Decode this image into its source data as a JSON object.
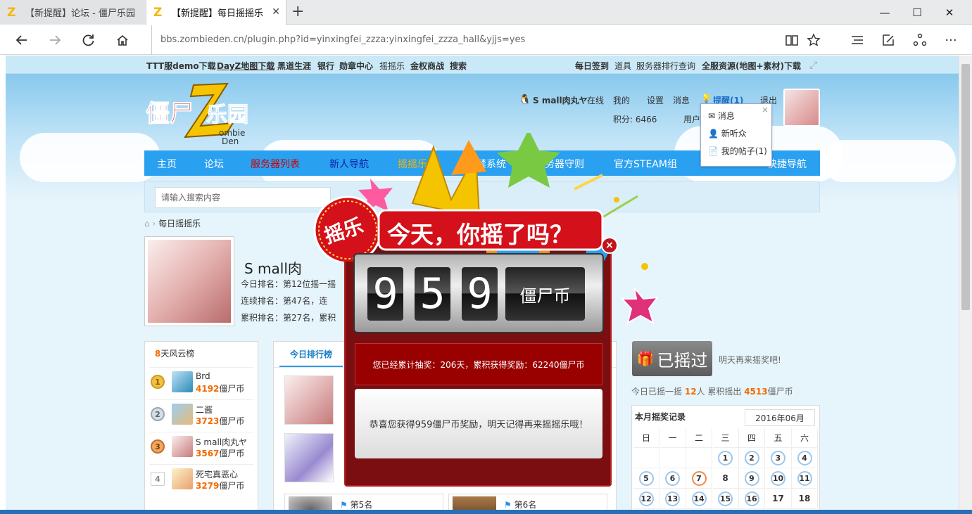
{
  "browser": {
    "tabs": [
      {
        "title": "【新提醒】论坛 - 僵尸乐园"
      },
      {
        "title": "【新提醒】每日摇摇乐"
      }
    ],
    "url": "bbs.zombieden.cn/plugin.php?id=yinxingfei_zzza:yinxingfei_zzza_hall&yjjs=yes",
    "window_controls": {
      "minimize": "—",
      "maximize": "☐",
      "close": "✕"
    }
  },
  "toplinks": {
    "left": [
      {
        "label": "TTT服demo下载",
        "color": "#0b4ab7"
      },
      {
        "label": "DayZ地图下载",
        "color": "#f5a100"
      },
      {
        "label": "黑道生涯",
        "color": "#d40000"
      },
      {
        "label": "银行",
        "color": "#0b4ab7"
      },
      {
        "label": "勋章中心",
        "color": "#0b4ab7"
      },
      {
        "label": "摇摇乐",
        "color": "#555555"
      },
      {
        "label": "金权商战",
        "color": "#1b7f1b"
      },
      {
        "label": "搜索",
        "color": "#333333"
      }
    ],
    "right": [
      {
        "label": "每日签到",
        "color": "#d40000"
      },
      {
        "label": "道具",
        "color": "#333333"
      },
      {
        "label": "服务器排行查询",
        "color": "#333333"
      },
      {
        "label": "全服资源(地图+素材)下载",
        "color": "#7b0fa8"
      }
    ]
  },
  "userbar": {
    "username": "S mall肉丸ヤ",
    "online": "在线",
    "mine": "我的",
    "settings": "设置",
    "messages": "消息",
    "reminder": "提醒(1)",
    "logout": "退出",
    "points": "积分: 6466",
    "user_group": "用户"
  },
  "notice_dropdown": {
    "items": [
      "消息",
      "新听众",
      "我的帖子(1)"
    ]
  },
  "mainnav": [
    {
      "label": "主页",
      "color": "#ffffff"
    },
    {
      "label": "论坛",
      "color": "#ffffff"
    },
    {
      "label": "服务器列表",
      "color": "#d00000"
    },
    {
      "label": "新人导航",
      "color": "#0a1fa8"
    },
    {
      "label": "摇摇乐",
      "color": "#f5b700"
    },
    {
      "label": "封禁系统",
      "color": "#ffffff"
    },
    {
      "label": "服务器守则",
      "color": "#ffffff"
    },
    {
      "label": "官方STEAM组",
      "color": "#ffffff"
    },
    {
      "label": "快捷导航",
      "color": "#ffffff"
    }
  ],
  "search": {
    "placeholder": "请输入搜索内容"
  },
  "breadcrumb": {
    "current": "每日摇摇乐"
  },
  "profile": {
    "name": "S mall肉",
    "today_rank": "今日排名：第12位摇一摇",
    "streak_rank": "连续排名：第47名，连",
    "total_rank": "累积排名：第27名，累积"
  },
  "left_board": {
    "title": "8天风云榜",
    "title_number": "8",
    "unit": "僵尸币",
    "rows": [
      {
        "rank": "1",
        "name": "Brd",
        "coins": "4192"
      },
      {
        "rank": "2",
        "name": "二酱",
        "coins": "3723"
      },
      {
        "rank": "3",
        "name": "S mall肉丸ヤ",
        "coins": "3567"
      },
      {
        "rank": "4",
        "name": "死宅真恶心",
        "coins": "3279"
      }
    ]
  },
  "mid_board": {
    "tab_label": "今日排行榜",
    "cards_bottom": [
      "第5名",
      "第6名"
    ]
  },
  "right_status": {
    "shaken_button": "已摇过",
    "tomorrow": "明天再来摇奖吧!",
    "summary_prefix": "今日已摇一摇",
    "summary_people": "12",
    "summary_mid": "人 累积摇出",
    "summary_coins": "4513",
    "summary_unit": "僵尸币"
  },
  "calendar": {
    "title": "本月摇奖记录",
    "month": "2016年06月",
    "weekdays": [
      "日",
      "一",
      "二",
      "三",
      "四",
      "五",
      "六"
    ],
    "rows": [
      [
        "",
        "",
        "",
        "1",
        "2",
        "3",
        "4"
      ],
      [
        "5",
        "6",
        "7",
        "8",
        "9",
        "10",
        "11"
      ],
      [
        "12",
        "13",
        "14",
        "15",
        "16",
        "17",
        "18"
      ]
    ],
    "highlight_day": "7",
    "no_ring": [
      "8",
      "17",
      "18"
    ]
  },
  "popup": {
    "banner_badge": "摇乐",
    "banner_text": "今天，你摇了吗？",
    "digits": [
      "9",
      "5",
      "9"
    ],
    "coin_label": "僵尸币",
    "accumulated": "您已经累计抽奖：206天，累积获得奖励：62240僵尸币",
    "congrats": "恭喜您获得959僵尸币奖励，明天记得再来摇摇乐哦！",
    "close_glyph": "×"
  },
  "colors": {
    "nav_bg": "#2aa0f0",
    "coin_orange": "#f46a00",
    "popup_red": "#7b0e10"
  }
}
